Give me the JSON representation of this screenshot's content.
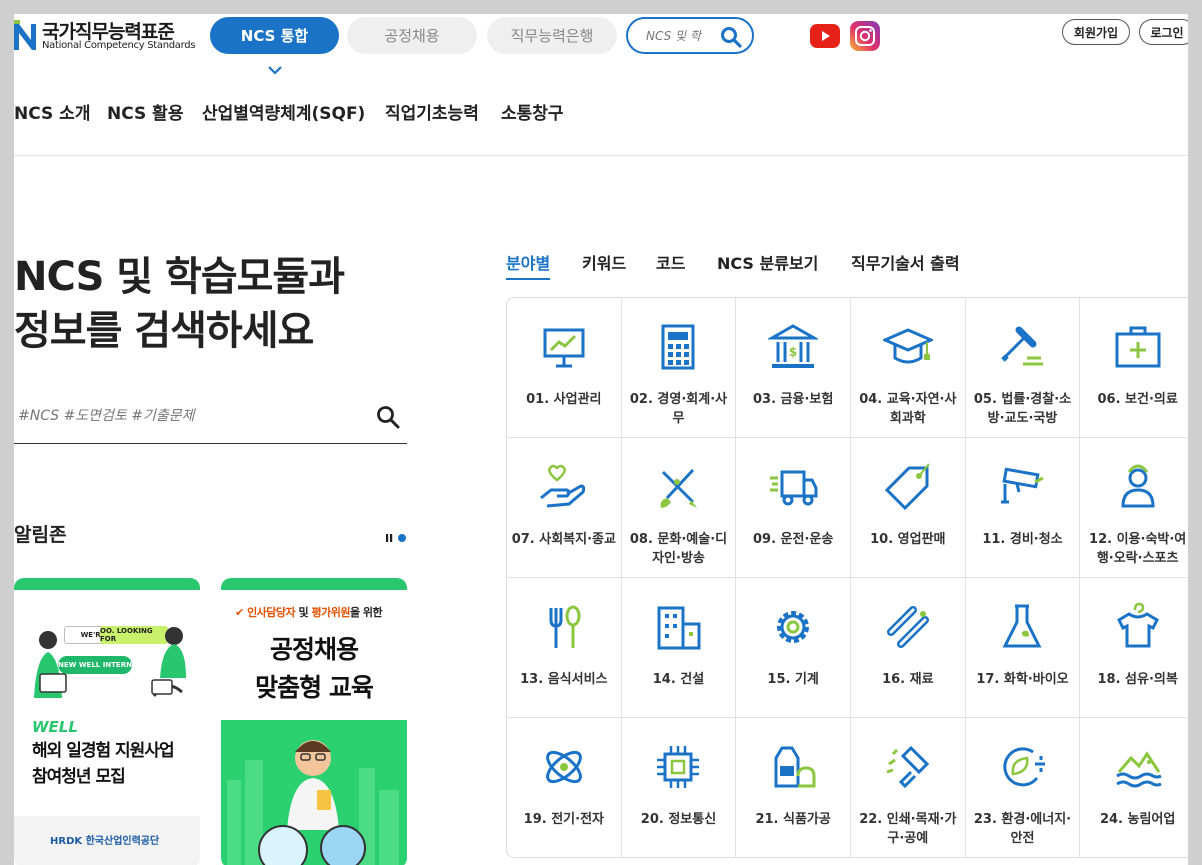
{
  "logo": {
    "title_ko": "국가직무능력표준",
    "title_en": "National Competency Standards"
  },
  "services": {
    "active": "NCS 통합",
    "items": [
      "공정채용",
      "직무능력은행"
    ]
  },
  "header_search": {
    "placeholder": "NCS 및 학"
  },
  "member": {
    "join": "회원가입",
    "login": "로그인"
  },
  "gnb": [
    "NCS 소개",
    "NCS 활용",
    "산업별역량체계(SQF)",
    "직업기초능력",
    "소통창구"
  ],
  "hero": {
    "line1": "NCS 및 학습모듈과",
    "line2": "정보를 검색하세요"
  },
  "main_search": {
    "placeholder": "#NCS #도면검토 #기출문제"
  },
  "notice": {
    "title": "알림존"
  },
  "cards": [
    {
      "btn1": "WE'RE",
      "btn2": "OO. LOOKING FOR",
      "btn3": "NEW WELL INTERN",
      "brand": "WELL",
      "line1": "해외 일경험 지원사업",
      "line2": "참여청년 모집",
      "org": "HRDK 한국산업인력공단"
    },
    {
      "tag_a": "인사담당자",
      "tag_mid": " 및 ",
      "tag_b": "평가위원",
      "tag_c": "을 위한",
      "line1": "공정채용",
      "line2": "맞춤형 교육"
    }
  ],
  "tabs": [
    "분야별",
    "키워드",
    "코드",
    "NCS 분류보기",
    "직무기술서 출력"
  ],
  "categories": [
    {
      "label": "01. 사업관리",
      "icon": "presentation-board-icon"
    },
    {
      "label": "02. 경영·회계·사무",
      "icon": "calculator-icon"
    },
    {
      "label": "03. 금융·보험",
      "icon": "bank-icon"
    },
    {
      "label": "04. 교육·자연·사회과학",
      "icon": "graduation-cap-icon"
    },
    {
      "label": "05. 법률·경찰·소방·교도·국방",
      "icon": "gavel-icon"
    },
    {
      "label": "06. 보건·의료",
      "icon": "first-aid-kit-icon"
    },
    {
      "label": "07. 사회복지·종교",
      "icon": "heart-hand-icon"
    },
    {
      "label": "08. 문화·예술·디자인·방송",
      "icon": "brush-pencil-icon"
    },
    {
      "label": "09. 운전·운송",
      "icon": "truck-icon"
    },
    {
      "label": "10. 영업판매",
      "icon": "price-tag-icon"
    },
    {
      "label": "11. 경비·청소",
      "icon": "cctv-camera-icon"
    },
    {
      "label": "12. 이용·숙박·여행·오락·스포츠",
      "icon": "person-icon"
    },
    {
      "label": "13. 음식서비스",
      "icon": "fork-spoon-icon"
    },
    {
      "label": "14. 건설",
      "icon": "building-icon"
    },
    {
      "label": "15. 기계",
      "icon": "gear-icon"
    },
    {
      "label": "16. 재료",
      "icon": "pipes-icon"
    },
    {
      "label": "17. 화학·바이오",
      "icon": "flask-icon"
    },
    {
      "label": "18. 섬유·의복",
      "icon": "shirt-icon"
    },
    {
      "label": "19. 전기·전자",
      "icon": "atom-icon"
    },
    {
      "label": "20. 정보통신",
      "icon": "chip-icon"
    },
    {
      "label": "21. 식품가공",
      "icon": "food-pack-icon"
    },
    {
      "label": "22. 인쇄·목재·가구·공예",
      "icon": "paint-roller-icon"
    },
    {
      "label": "23. 환경·에너지·안전",
      "icon": "eco-plug-icon"
    },
    {
      "label": "24. 농림어업",
      "icon": "field-wave-icon"
    }
  ],
  "colors": {
    "accent": "#1a73c6",
    "green": "#8cc63f",
    "youtube": "#e62117"
  }
}
